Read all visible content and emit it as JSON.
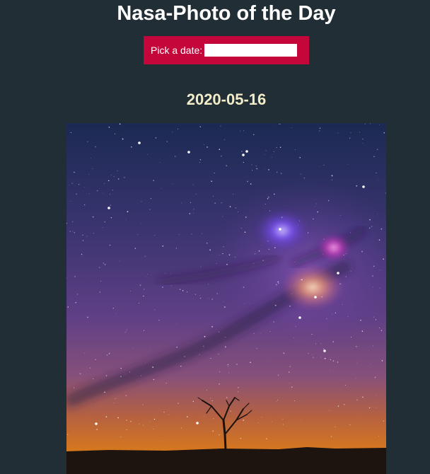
{
  "app": {
    "title": "Nasa-Photo of the Day"
  },
  "date_picker": {
    "label": "Pick a date:",
    "value": ""
  },
  "apod": {
    "date": "2020-05-16",
    "image_subject": "rho-ophiuchi-night-sky"
  },
  "colors": {
    "background": "#212e36",
    "date_box": "#c4063a",
    "date_heading": "#f2ecc8",
    "title": "#ffffff"
  }
}
